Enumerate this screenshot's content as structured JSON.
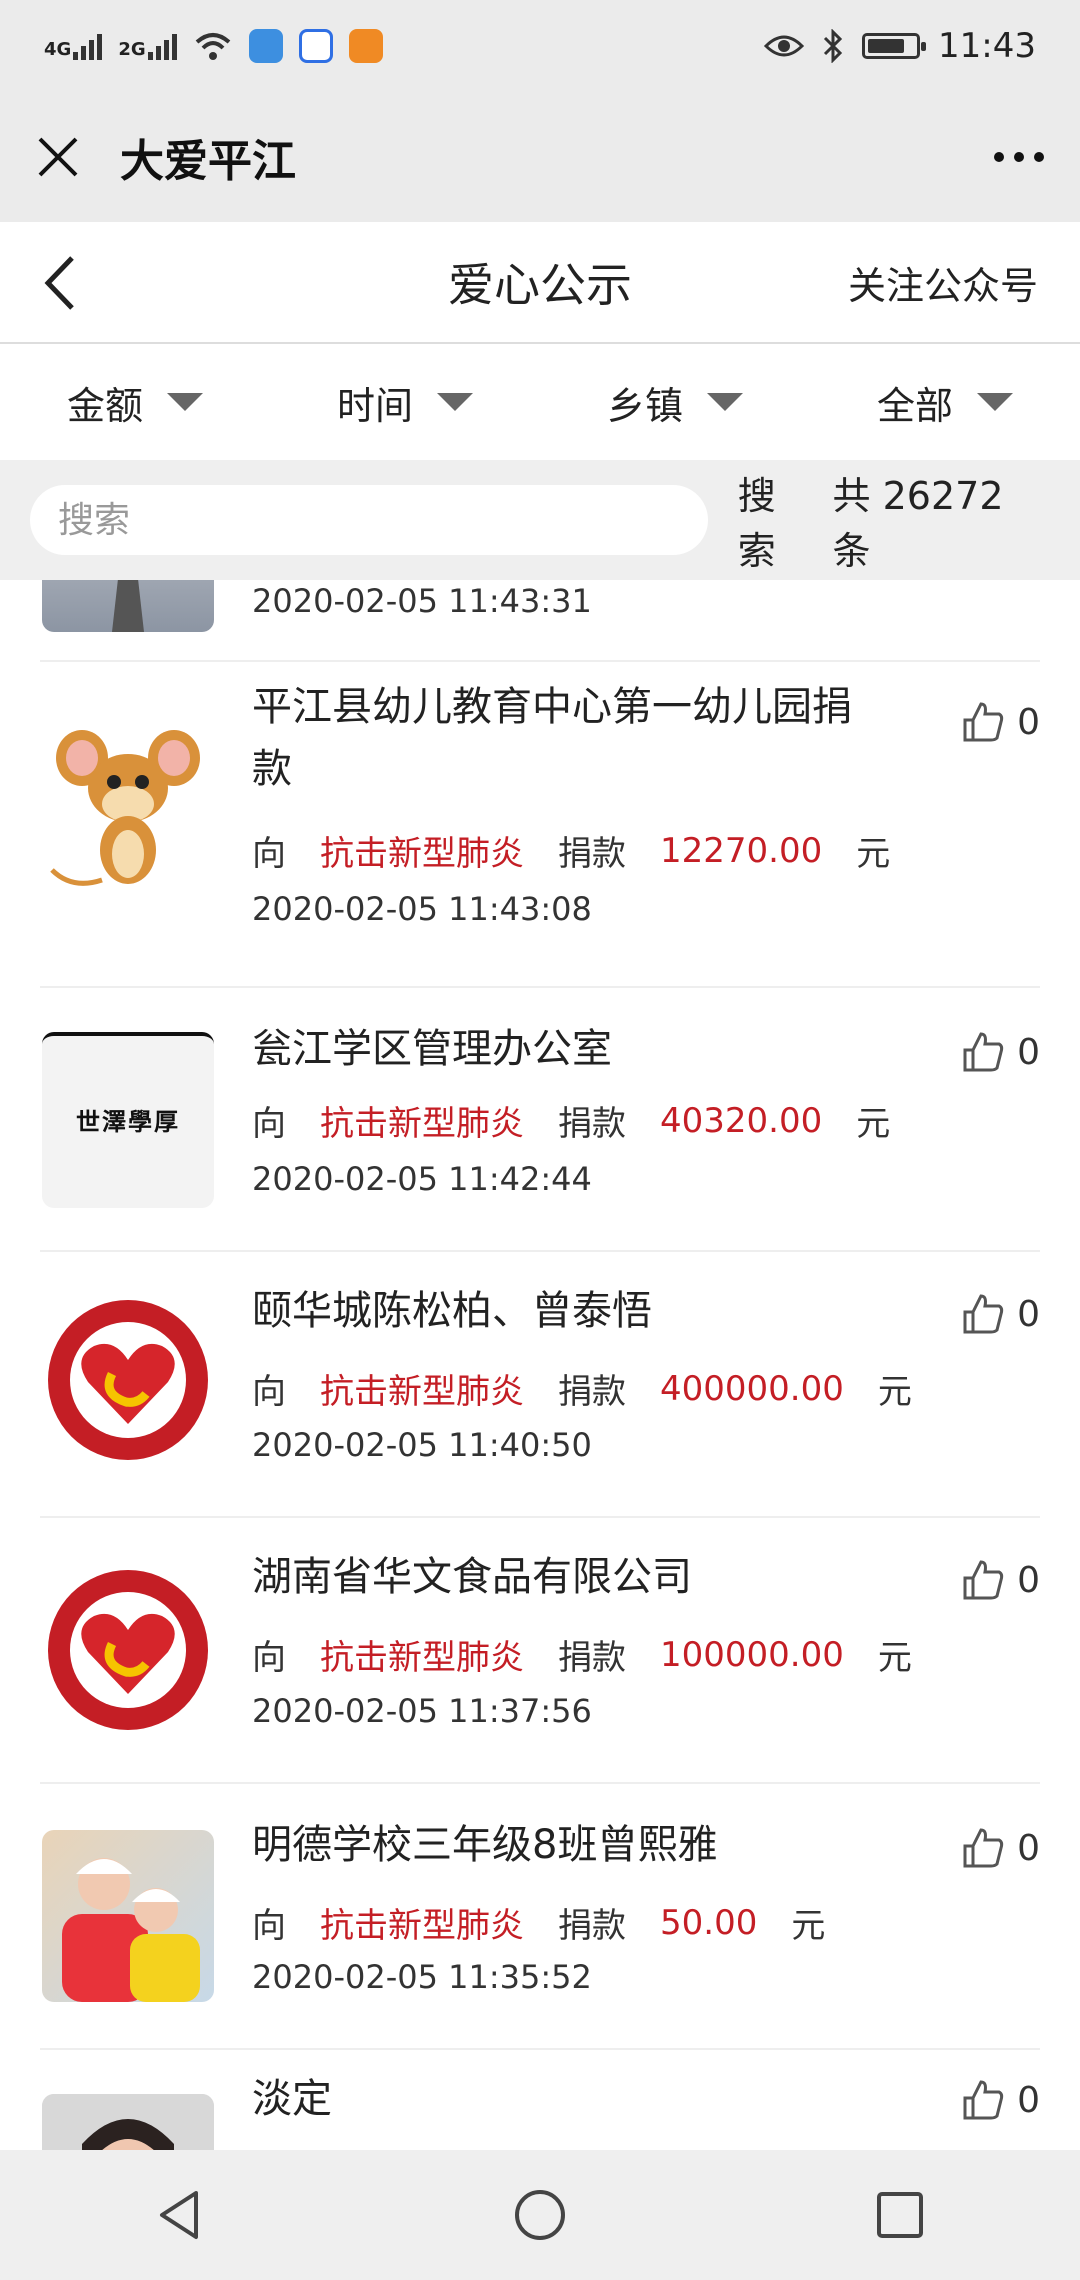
{
  "status_bar": {
    "network1": "4G",
    "network2": "2G",
    "time": "11:43",
    "battery_level": 0.75
  },
  "wechat_bar": {
    "title": "大爱平江"
  },
  "nav": {
    "title": "爱心公示",
    "follow_label": "关注公众号"
  },
  "filters": [
    {
      "label": "金额"
    },
    {
      "label": "时间"
    },
    {
      "label": "乡镇"
    },
    {
      "label": "全部"
    }
  ],
  "search": {
    "placeholder": "搜索",
    "button_label": "搜索",
    "count_text": "共 26272 条"
  },
  "partial_top_row": {
    "date": "2020-02-05 11:43:31"
  },
  "items": [
    {
      "name": "平江县幼儿教育中心第一幼儿园捐款",
      "to_label": "向",
      "cause": "抗击新型肺炎",
      "donate_label": "捐款",
      "amount": "12270.00",
      "unit": "元",
      "date": "2020-02-05 11:43:08",
      "likes": "0",
      "avatar": "cartoon-mouse"
    },
    {
      "name": "瓮江学区管理办公室",
      "to_label": "向",
      "cause": "抗击新型肺炎",
      "donate_label": "捐款",
      "amount": "40320.00",
      "unit": "元",
      "date": "2020-02-05 11:42:44",
      "likes": "0",
      "avatar": "calligraphy",
      "avatar_text": "世澤學厚"
    },
    {
      "name": "颐华城陈松柏、曾泰悟",
      "to_label": "向",
      "cause": "抗击新型肺炎",
      "donate_label": "捐款",
      "amount": "400000.00",
      "unit": "元",
      "date": "2020-02-05 11:40:50",
      "likes": "0",
      "avatar": "dapj-logo"
    },
    {
      "name": "湖南省华文食品有限公司",
      "to_label": "向",
      "cause": "抗击新型肺炎",
      "donate_label": "捐款",
      "amount": "100000.00",
      "unit": "元",
      "date": "2020-02-05 11:37:56",
      "likes": "0",
      "avatar": "dapj-logo"
    },
    {
      "name": "明德学校三年级8班曾熙雅",
      "to_label": "向",
      "cause": "抗击新型肺炎",
      "donate_label": "捐款",
      "amount": "50.00",
      "unit": "元",
      "date": "2020-02-05 11:35:52",
      "likes": "0",
      "avatar": "photo-kids"
    },
    {
      "name": "淡定",
      "likes": "0",
      "avatar": "photo-person"
    }
  ],
  "colors": {
    "accent_red": "#c41e25",
    "bar_bg": "#ebebeb"
  },
  "icons": {
    "close": "close-icon",
    "more": "more-icon",
    "back": "back-arrow-icon",
    "like": "thumbs-up-icon",
    "nav_back": "triangle-back-icon",
    "nav_home": "circle-home-icon",
    "nav_recent": "square-recents-icon"
  }
}
